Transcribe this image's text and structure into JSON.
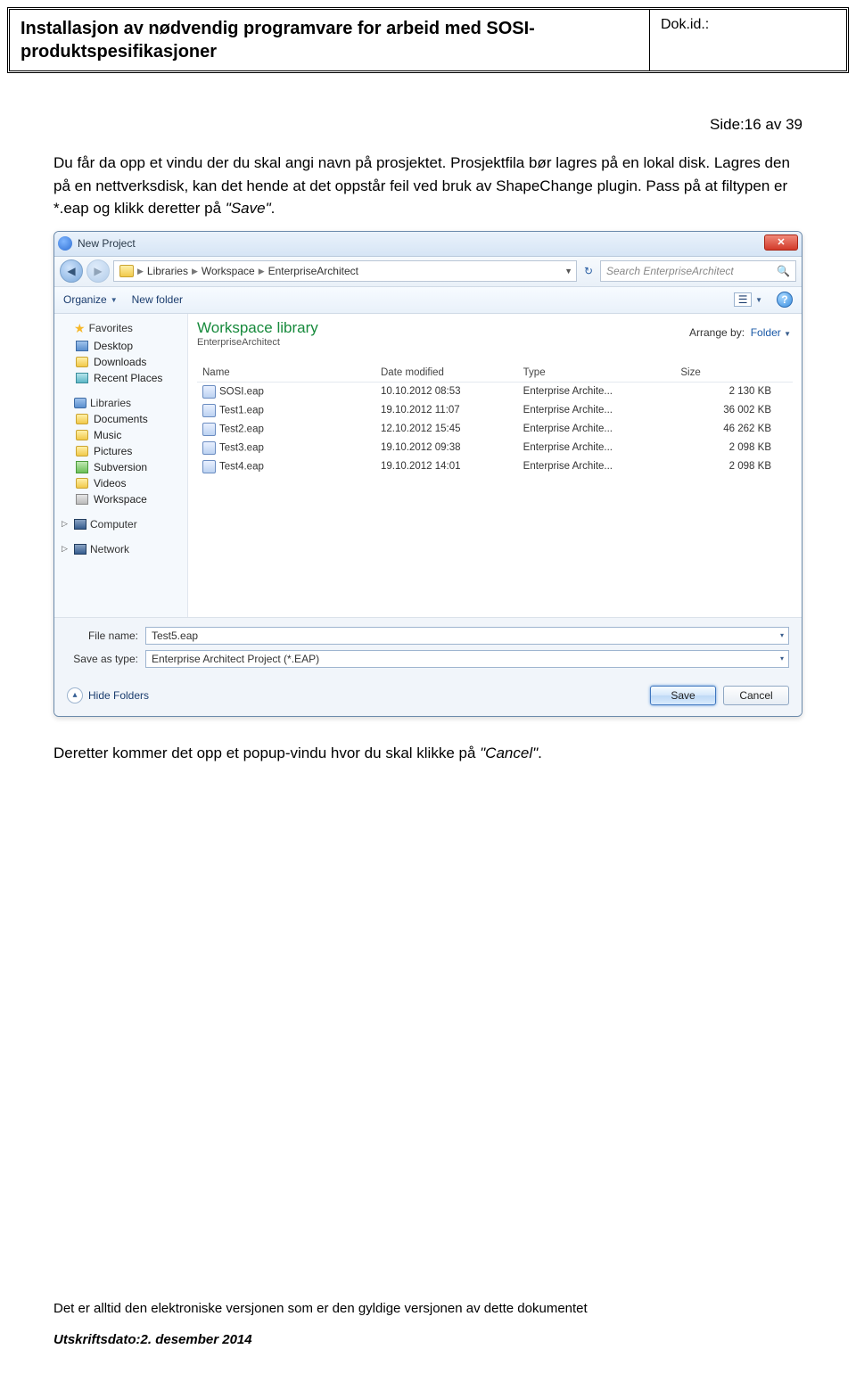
{
  "header": {
    "title": "Installasjon av nødvendig programvare for arbeid med SOSI-produktspesifikasjoner",
    "dokid_label": "Dok.id.:"
  },
  "page_number": "Side:16 av 39",
  "para1_a": "Du får da opp et vindu der du skal angi navn på prosjektet. Prosjektfila bør lagres på en lokal disk. Lagres den på en nettverksdisk, kan det hende at det oppstår feil ved bruk av ShapeChange plugin. Pass på at filtypen er *.eap og klikk deretter på ",
  "para1_b": "\"Save\"",
  "para1_c": ".",
  "para2_a": "Deretter kommer det opp et popup-vindu hvor du skal klikke på ",
  "para2_b": "\"Cancel\"",
  "para2_c": ".",
  "footer_note": "Det er alltid den elektroniske versjonen som er den gyldige versjonen av dette dokumentet",
  "footer_date_label": "Utskriftsdato:",
  "footer_date_value": "2. desember 2014",
  "dialog": {
    "title": "New Project",
    "breadcrumb": {
      "p1": "Libraries",
      "p2": "Workspace",
      "p3": "EnterpriseArchitect"
    },
    "search_placeholder": "Search EnterpriseArchitect",
    "toolbar": {
      "organize": "Organize",
      "new_folder": "New folder"
    },
    "sidebar": {
      "favorites": "Favorites",
      "desktop": "Desktop",
      "downloads": "Downloads",
      "recent": "Recent Places",
      "libraries": "Libraries",
      "documents": "Documents",
      "music": "Music",
      "pictures": "Pictures",
      "subversion": "Subversion",
      "videos": "Videos",
      "workspace": "Workspace",
      "computer": "Computer",
      "network": "Network"
    },
    "content": {
      "heading": "Workspace library",
      "sub": "EnterpriseArchitect",
      "arrange_label": "Arrange by:",
      "arrange_value": "Folder",
      "cols": {
        "name": "Name",
        "date": "Date modified",
        "type": "Type",
        "size": "Size"
      },
      "rows": [
        {
          "name": "SOSI.eap",
          "date": "10.10.2012 08:53",
          "type": "Enterprise Archite...",
          "size": "2 130 KB"
        },
        {
          "name": "Test1.eap",
          "date": "19.10.2012 11:07",
          "type": "Enterprise Archite...",
          "size": "36 002 KB"
        },
        {
          "name": "Test2.eap",
          "date": "12.10.2012 15:45",
          "type": "Enterprise Archite...",
          "size": "46 262 KB"
        },
        {
          "name": "Test3.eap",
          "date": "19.10.2012 09:38",
          "type": "Enterprise Archite...",
          "size": "2 098 KB"
        },
        {
          "name": "Test4.eap",
          "date": "19.10.2012 14:01",
          "type": "Enterprise Archite...",
          "size": "2 098 KB"
        }
      ]
    },
    "lower": {
      "filename_label": "File name:",
      "filename_value": "Test5.eap",
      "savetype_label": "Save as type:",
      "savetype_value": "Enterprise Architect Project (*.EAP)",
      "hide_folders": "Hide Folders",
      "save": "Save",
      "cancel": "Cancel"
    }
  }
}
